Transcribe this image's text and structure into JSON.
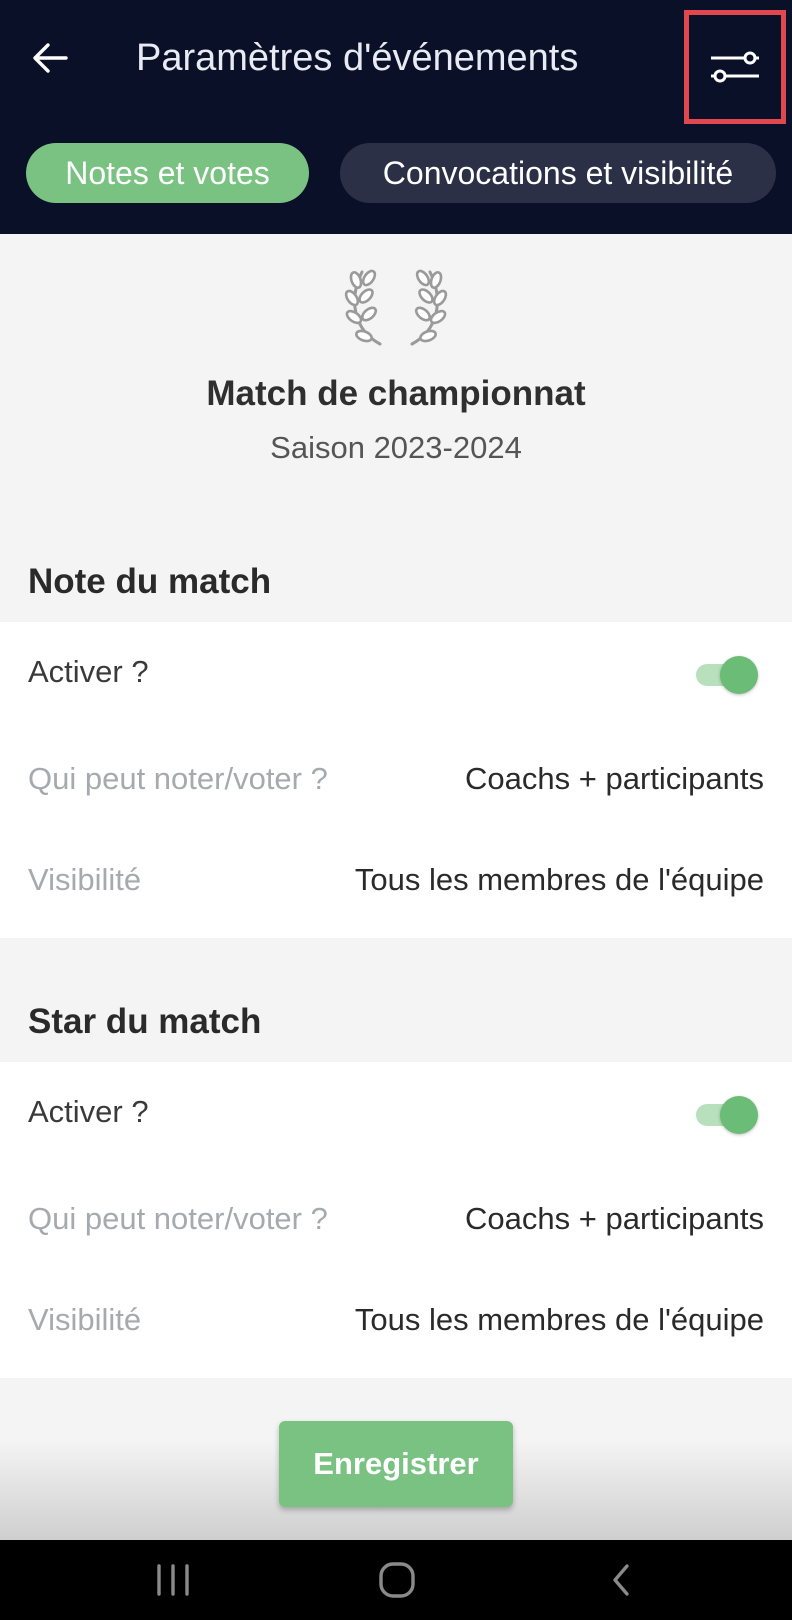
{
  "header": {
    "title": "Paramètres d'événements",
    "back_icon": "arrow-left-icon",
    "filter_icon": "sliders-icon",
    "highlight_color": "#e0474f"
  },
  "tabs": [
    {
      "label": "Notes et votes",
      "active": true
    },
    {
      "label": "Convocations et visibilité",
      "active": false
    }
  ],
  "event": {
    "icon": "laurel-wreath-icon",
    "title": "Match de championnat",
    "season": "Saison 2023-2024"
  },
  "sections": [
    {
      "heading": "Note du match",
      "enable_label": "Activer ?",
      "enabled": true,
      "who_label": "Qui peut noter/voter ?",
      "who_value": "Coachs + participants",
      "visibility_label": "Visibilité",
      "visibility_value": "Tous les membres de l'équipe"
    },
    {
      "heading": "Star du match",
      "enable_label": "Activer ?",
      "enabled": true,
      "who_label": "Qui peut noter/voter ?",
      "who_value": "Coachs + participants",
      "visibility_label": "Visibilité",
      "visibility_value": "Tous les membres de l'équipe"
    }
  ],
  "footer": {
    "save_label": "Enregistrer"
  },
  "colors": {
    "header_bg": "#0a1028",
    "accent_green": "#79c282",
    "inactive_tab": "#2c3046"
  },
  "system_nav": [
    "recent-apps-icon",
    "home-icon",
    "back-chevron-icon"
  ]
}
